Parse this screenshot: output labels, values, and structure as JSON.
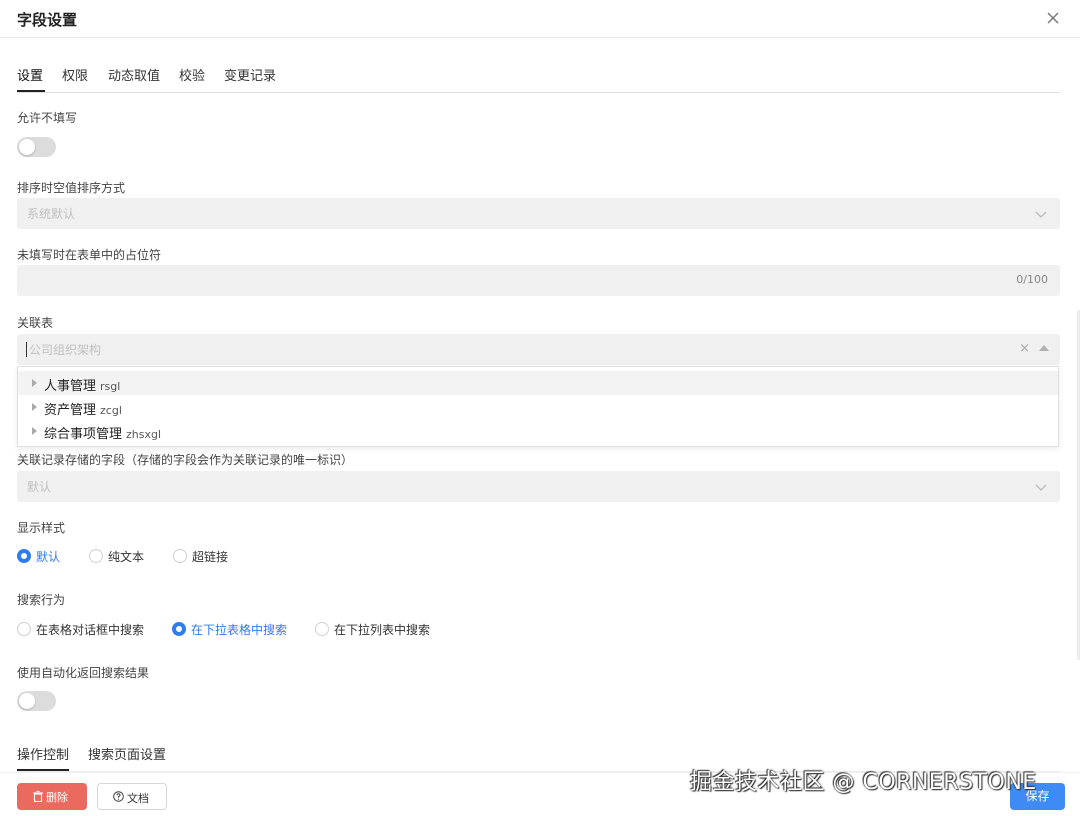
{
  "dialog": {
    "title": "字段设置"
  },
  "tabs": [
    "设置",
    "权限",
    "动态取值",
    "校验",
    "变更记录"
  ],
  "allow_empty": {
    "label": "允许不填写",
    "enabled": false
  },
  "sort_empty": {
    "label": "排序时空值排序方式",
    "value": "系统默认"
  },
  "placeholder_field": {
    "label": "未填写时在表单中的占位符",
    "value": "",
    "counter": "0/100"
  },
  "related_table": {
    "label": "关联表",
    "placeholder": "公司组织架构",
    "clear_icon": "×",
    "options": [
      {
        "name": "人事管理",
        "code": "rsgl"
      },
      {
        "name": "资产管理",
        "code": "zcgl"
      },
      {
        "name": "综合事项管理",
        "code": "zhsxgl"
      }
    ]
  },
  "stored_field": {
    "label": "关联记录存储的字段（存储的字段会作为关联记录的唯一标识）",
    "value": "默认"
  },
  "display_style": {
    "label": "显示样式",
    "options": [
      "默认",
      "纯文本",
      "超链接"
    ],
    "selected": "默认"
  },
  "search_behavior": {
    "label": "搜索行为",
    "options": [
      "在表格对话框中搜索",
      "在下拉表格中搜索",
      "在下拉列表中搜索"
    ],
    "selected": "在下拉表格中搜索"
  },
  "auto_return": {
    "label": "使用自动化返回搜索结果",
    "enabled": false
  },
  "sub_tabs": [
    "操作控制",
    "搜索页面设置"
  ],
  "footer": {
    "delete": "删除",
    "docs": "文档",
    "save": "保存"
  },
  "watermark": "掘金技术社区 @ CORNERSTONE",
  "colors": {
    "primary": "#3f8bf5",
    "danger": "#ea6a5f",
    "radio_checked": "#2f7bf0"
  }
}
